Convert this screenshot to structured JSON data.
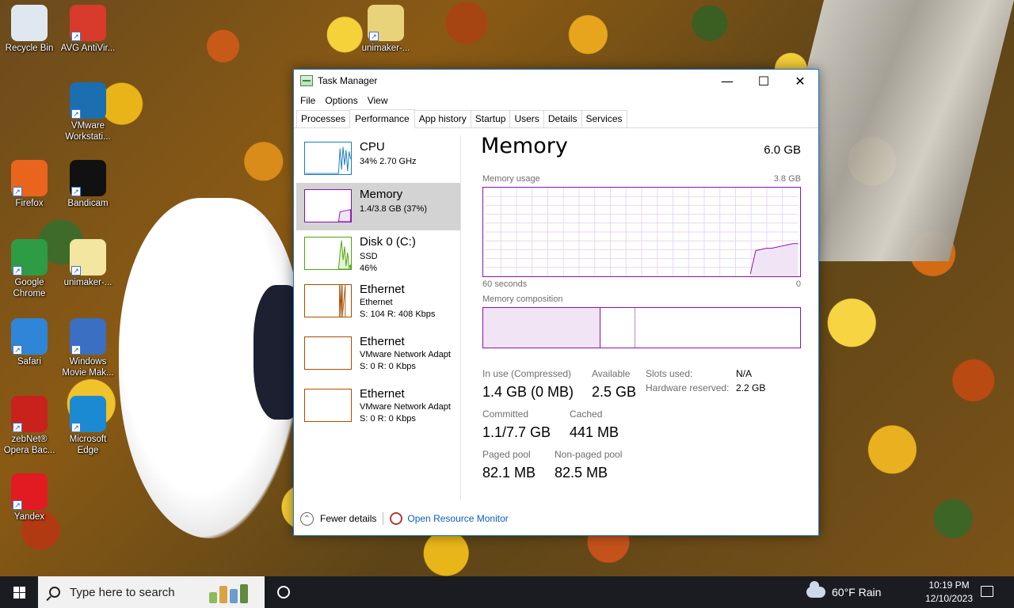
{
  "desktop": {
    "icons": [
      {
        "label": "Recycle Bin",
        "color": "#dfe8f1",
        "icon": "recycle-bin-icon"
      },
      {
        "label": "AVG AntiVir...",
        "color": "#d83a2b",
        "icon": "avg-icon"
      },
      {
        "label": "unimaker-...",
        "color": "#e8d27a",
        "icon": "zip-folder-icon"
      },
      {
        "label": "VMware Workstati...",
        "color": "#1b6fb0",
        "icon": "vmware-icon"
      },
      {
        "label": "Firefox",
        "color": "#e9651d",
        "icon": "firefox-icon"
      },
      {
        "label": "Bandicam",
        "color": "#111111",
        "icon": "bandicam-icon"
      },
      {
        "label": "Google Chrome",
        "color": "#2e9b45",
        "icon": "chrome-icon"
      },
      {
        "label": "unimaker-...",
        "color": "#f2e6a0",
        "icon": "file-icon"
      },
      {
        "label": "Safari",
        "color": "#2f86d8",
        "icon": "safari-icon"
      },
      {
        "label": "Windows Movie Mak...",
        "color": "#3b6fc2",
        "icon": "movie-maker-icon"
      },
      {
        "label": "zebNet® Opera Bac...",
        "color": "#c9221c",
        "icon": "opera-backup-icon"
      },
      {
        "label": "Microsoft Edge",
        "color": "#1b8ad3",
        "icon": "edge-icon"
      },
      {
        "label": "Yandex",
        "color": "#e21b22",
        "icon": "yandex-icon"
      }
    ]
  },
  "taskmanager": {
    "title": "Task Manager",
    "controls": {
      "minimize": "—",
      "maximize": "☐",
      "close": "✕"
    },
    "menu": [
      "File",
      "Options",
      "View"
    ],
    "tabs": [
      "Processes",
      "Performance",
      "App history",
      "Startup",
      "Users",
      "Details",
      "Services"
    ],
    "active_tab": "Performance",
    "sidebar": [
      {
        "name": "CPU",
        "sub1": "34%  2.70 GHz",
        "sub2": "",
        "sub3": "",
        "color": "#1c7bc4"
      },
      {
        "name": "Memory",
        "sub1": "1.4/3.8 GB (37%)",
        "sub2": "",
        "sub3": "",
        "color": "#8b12ae"
      },
      {
        "name": "Disk 0 (C:)",
        "sub1": "SSD",
        "sub2": "46%",
        "sub3": "",
        "color": "#4da60c"
      },
      {
        "name": "Ethernet",
        "sub1": "Ethernet",
        "sub2": "S: 104  R: 408 Kbps",
        "sub3": "",
        "color": "#a74f01"
      },
      {
        "name": "Ethernet",
        "sub1": "VMware Network Adapt",
        "sub2": "S: 0  R: 0 Kbps",
        "sub3": "",
        "color": "#a74f01"
      },
      {
        "name": "Ethernet",
        "sub1": "VMware Network Adapt",
        "sub2": "S: 0  R: 0 Kbps",
        "sub3": "",
        "color": "#a74f01"
      }
    ],
    "detail": {
      "title": "Memory",
      "total": "6.0 GB",
      "usage_label": "Memory usage",
      "usage_max": "3.8 GB",
      "axis_left": "60 seconds",
      "axis_right": "0",
      "composition_label": "Memory composition",
      "composition": {
        "in_use_fraction": 0.37,
        "modified_fraction": 0.11
      },
      "usage_series_gb": [
        0,
        0,
        0,
        0,
        0,
        0,
        0,
        0,
        0,
        0,
        0,
        0,
        0,
        0,
        0,
        0,
        0,
        0,
        0,
        0,
        0,
        0,
        0,
        0,
        0,
        0,
        0,
        0,
        0,
        0,
        0,
        0,
        0,
        0,
        0,
        0,
        0,
        0,
        0,
        0,
        0,
        0,
        0,
        0,
        0,
        0,
        0,
        0,
        0,
        0,
        0.1,
        1.1,
        1.15,
        1.2,
        1.2,
        1.25,
        1.3,
        1.35,
        1.4,
        1.4
      ],
      "stats": {
        "in_use_label": "In use (Compressed)",
        "in_use_value": "1.4 GB (0 MB)",
        "available_label": "Available",
        "available_value": "2.5 GB",
        "committed_label": "Committed",
        "committed_value": "1.1/7.7 GB",
        "cached_label": "Cached",
        "cached_value": "441 MB",
        "paged_label": "Paged pool",
        "paged_value": "82.1 MB",
        "nonpaged_label": "Non-paged pool",
        "nonpaged_value": "82.5 MB",
        "slots_label": "Slots used:",
        "slots_value": "N/A",
        "hwres_label": "Hardware reserved:",
        "hwres_value": "2.2 GB"
      }
    },
    "footer": {
      "fewer_details": "Fewer details",
      "resource_monitor": "Open Resource Monitor"
    }
  },
  "taskbar": {
    "search_placeholder": "Type here to search",
    "weather": "60°F  Rain",
    "time": "10:19 PM",
    "date": "12/10/2023"
  }
}
